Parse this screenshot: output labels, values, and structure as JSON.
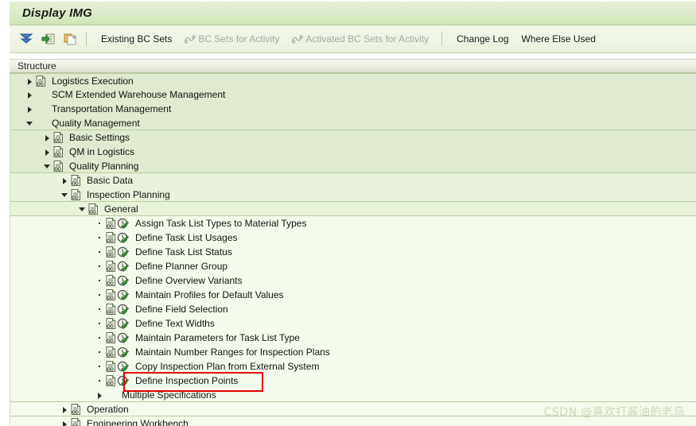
{
  "window": {
    "title": "Display IMG"
  },
  "toolbar": {
    "icons": [
      {
        "name": "collapse-all-icon",
        "label": "collapse-all"
      },
      {
        "name": "expand-node-icon",
        "label": "expand-node"
      },
      {
        "name": "copy-clipboard-icon",
        "label": "copy"
      }
    ],
    "buttons": [
      {
        "name": "existing-bc-sets-button",
        "label": "Existing BC Sets",
        "disabled": false,
        "icon": false
      },
      {
        "name": "bc-sets-for-activity-button",
        "label": "BC Sets for Activity",
        "disabled": true,
        "icon": true
      },
      {
        "name": "activated-bc-sets-for-activity-button",
        "label": "Activated BC Sets for Activity",
        "disabled": true,
        "icon": true
      },
      {
        "name": "change-log-button",
        "label": "Change Log",
        "disabled": false,
        "icon": false
      },
      {
        "name": "where-else-used-button",
        "label": "Where Else Used",
        "disabled": false,
        "icon": false
      }
    ]
  },
  "structure": {
    "header": "Structure",
    "rows": [
      {
        "label": "Logistics Execution",
        "level": 1,
        "twisty": "right",
        "doc": true,
        "activity": false,
        "band": "a",
        "sepTop": true
      },
      {
        "label": "SCM Extended Warehouse Management",
        "level": 1,
        "twisty": "right",
        "doc": false,
        "activity": false,
        "band": "a"
      },
      {
        "label": "Transportation Management",
        "level": 1,
        "twisty": "right",
        "doc": false,
        "activity": false,
        "band": "a"
      },
      {
        "label": "Quality Management",
        "level": 1,
        "twisty": "down",
        "doc": false,
        "activity": false,
        "band": "a",
        "sepBot": true
      },
      {
        "label": "Basic Settings",
        "level": 2,
        "twisty": "right",
        "doc": true,
        "activity": false,
        "band": "a"
      },
      {
        "label": "QM in Logistics",
        "level": 2,
        "twisty": "right",
        "doc": true,
        "activity": false,
        "band": "a"
      },
      {
        "label": "Quality Planning",
        "level": 2,
        "twisty": "down",
        "doc": true,
        "activity": false,
        "band": "a",
        "sepBot": true
      },
      {
        "label": "Basic Data",
        "level": 3,
        "twisty": "right",
        "doc": true,
        "activity": false,
        "band": "b"
      },
      {
        "label": "Inspection Planning",
        "level": 3,
        "twisty": "down",
        "doc": true,
        "activity": false,
        "band": "b",
        "sepBot": true
      },
      {
        "label": "General",
        "level": 4,
        "twisty": "down",
        "doc": true,
        "activity": false,
        "band": "b",
        "sepBot": true
      },
      {
        "label": "Assign Task List Types to Material Types",
        "level": 5,
        "twisty": "dot",
        "doc": true,
        "activity": true,
        "band": "c"
      },
      {
        "label": "Define Task List Usages",
        "level": 5,
        "twisty": "dot",
        "doc": true,
        "activity": true,
        "band": "c"
      },
      {
        "label": "Define Task List Status",
        "level": 5,
        "twisty": "dot",
        "doc": true,
        "activity": true,
        "band": "c"
      },
      {
        "label": "Define Planner Group",
        "level": 5,
        "twisty": "dot",
        "doc": true,
        "activity": true,
        "band": "c"
      },
      {
        "label": "Define Overview Variants",
        "level": 5,
        "twisty": "dot",
        "doc": true,
        "activity": true,
        "band": "c"
      },
      {
        "label": "Maintain Profiles for Default Values",
        "level": 5,
        "twisty": "dot",
        "doc": true,
        "activity": true,
        "band": "c"
      },
      {
        "label": "Define Field Selection",
        "level": 5,
        "twisty": "dot",
        "doc": true,
        "activity": true,
        "band": "c"
      },
      {
        "label": "Define Text Widths",
        "level": 5,
        "twisty": "dot",
        "doc": true,
        "activity": true,
        "band": "c"
      },
      {
        "label": "Maintain Parameters for Task List Type",
        "level": 5,
        "twisty": "dot",
        "doc": true,
        "activity": true,
        "band": "c"
      },
      {
        "label": "Maintain Number Ranges for Inspection Plans",
        "level": 5,
        "twisty": "dot",
        "doc": true,
        "activity": true,
        "band": "c"
      },
      {
        "label": "Copy Inspection Plan from External System",
        "level": 5,
        "twisty": "dot",
        "doc": true,
        "activity": true,
        "band": "c"
      },
      {
        "label": "Define Inspection Points",
        "level": 5,
        "twisty": "dot",
        "doc": true,
        "activity": true,
        "band": "c",
        "highlighted": true
      },
      {
        "label": "Multiple Specifications",
        "level": 5,
        "twisty": "right",
        "doc": false,
        "activity": false,
        "band": "c",
        "sepBot": true
      },
      {
        "label": "Operation",
        "level": 3,
        "twisty": "right",
        "doc": true,
        "activity": false,
        "band": "c",
        "sepBot": true
      },
      {
        "label": "Engineering Workbench",
        "level": 3,
        "twisty": "right",
        "doc": true,
        "activity": false,
        "band": "c"
      }
    ]
  },
  "annotation": {
    "highlight_color": "#e60000",
    "highlight_target": "Define Inspection Points"
  },
  "watermark": {
    "text": "CSDN @喜欢打酱油的老鸟"
  }
}
